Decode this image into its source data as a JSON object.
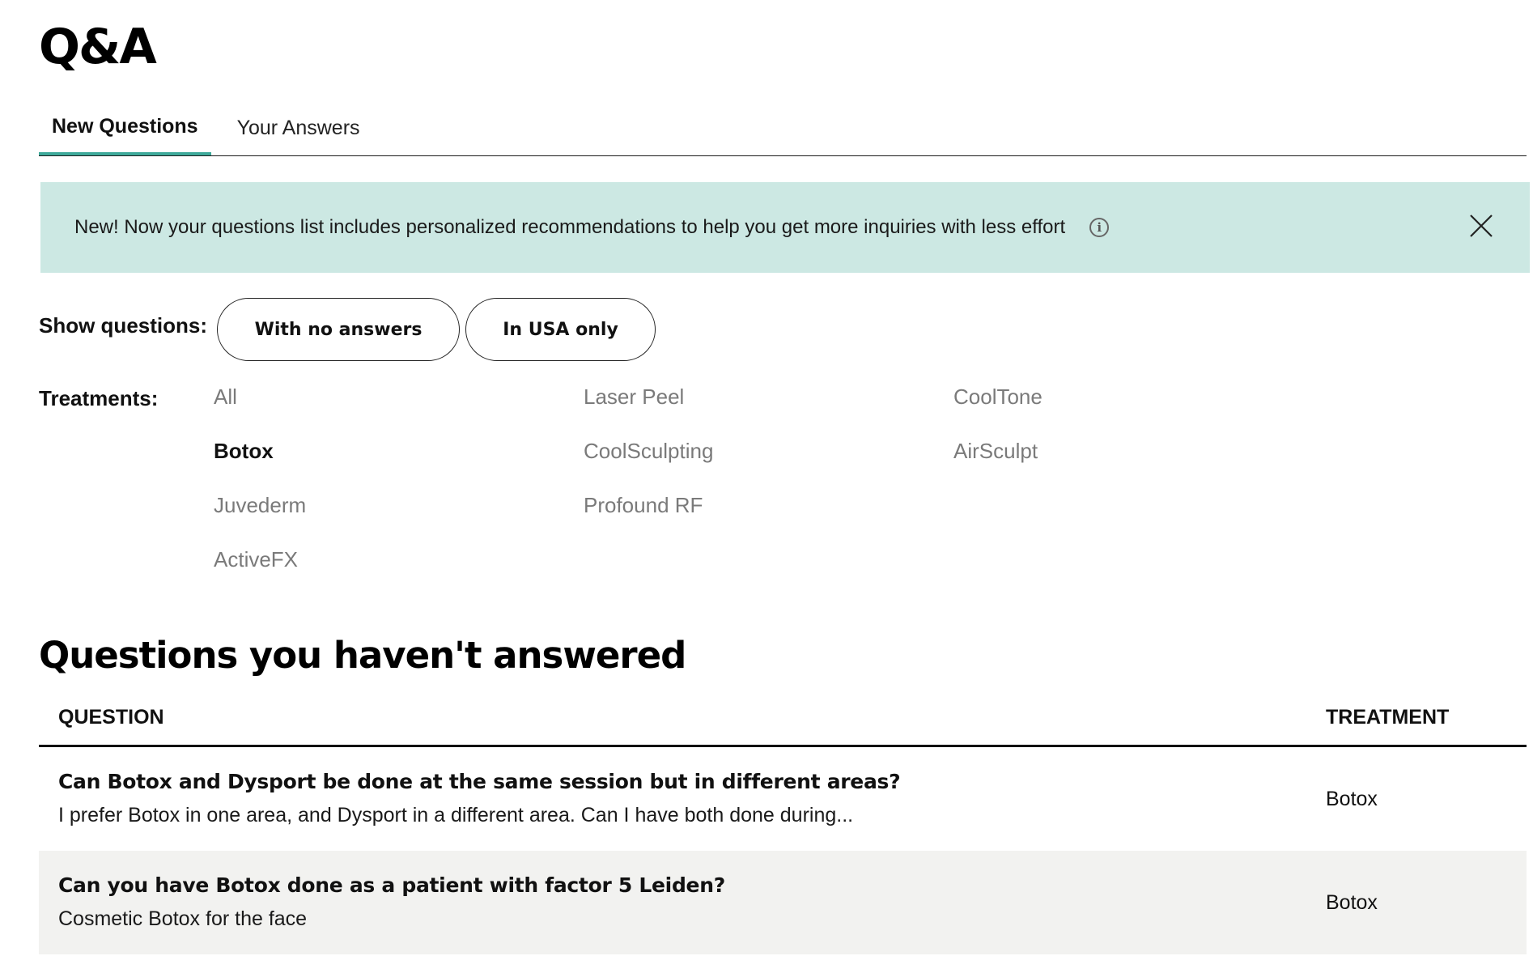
{
  "page": {
    "title": "Q&A"
  },
  "tabs": [
    {
      "label": "New Questions",
      "active": true
    },
    {
      "label": "Your Answers",
      "active": false
    }
  ],
  "banner": {
    "text": "New! Now your questions list includes personalized recommendations to help you get more inquiries with less effort",
    "info_icon": "info-circle-icon",
    "close_icon": "close-x-icon",
    "background": "#cce8e3"
  },
  "filters": {
    "show_label": "Show questions:",
    "pills": [
      {
        "label": "With no answers"
      },
      {
        "label": "In USA only"
      }
    ],
    "treatments_label": "Treatments:",
    "treatments": [
      {
        "label": "All",
        "selected": false
      },
      {
        "label": "Laser Peel",
        "selected": false
      },
      {
        "label": "CoolTone",
        "selected": false
      },
      {
        "label": "Botox",
        "selected": true
      },
      {
        "label": "CoolSculpting",
        "selected": false
      },
      {
        "label": "AirSculpt",
        "selected": false
      },
      {
        "label": "Juvederm",
        "selected": false
      },
      {
        "label": "Profound RF",
        "selected": false
      },
      {
        "label": "",
        "selected": false
      },
      {
        "label": "ActiveFX",
        "selected": false
      }
    ]
  },
  "section": {
    "title": "Questions you haven't answered"
  },
  "table": {
    "columns": {
      "question": "QUESTION",
      "treatment": "TREATMENT"
    },
    "rows": [
      {
        "title": "Can Botox and Dysport be done at the same session but in different areas?",
        "description": "I prefer Botox in one area, and Dysport in a different area. Can I have both done during...",
        "treatment": "Botox"
      },
      {
        "title": "Can you have Botox done as a patient with factor 5 Leiden?",
        "description": "Cosmetic Botox for the face",
        "treatment": "Botox"
      }
    ]
  },
  "colors": {
    "accent": "#3ea99a",
    "row_alt": "#f2f2f0",
    "muted_text": "#7a7a7a"
  }
}
